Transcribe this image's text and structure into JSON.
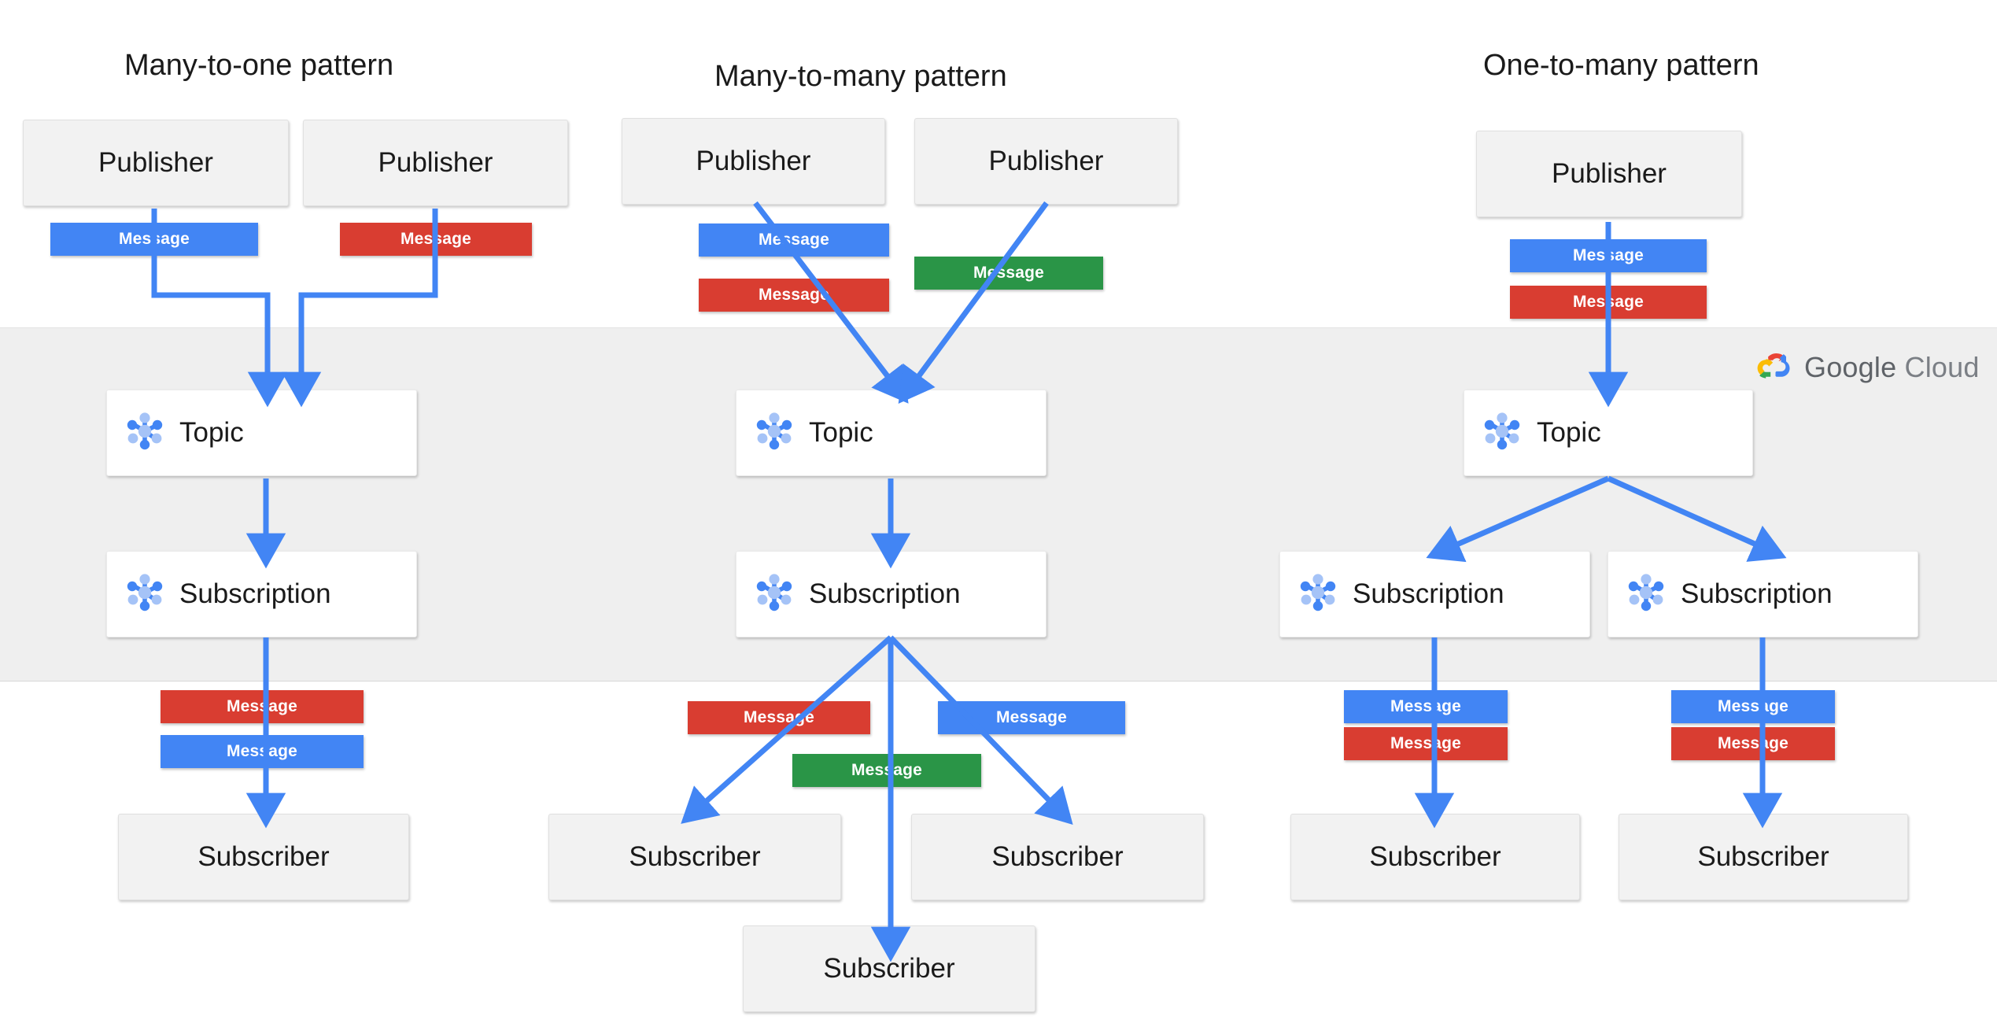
{
  "diagram": {
    "title": "Google Cloud Pub/Sub messaging patterns",
    "brand": {
      "name_first": "Google",
      "name_second": "Cloud",
      "logo_colors": {
        "red": "#EA4335",
        "yellow": "#FBBC05",
        "green": "#34A853",
        "blue": "#4285F4"
      },
      "text_color": "#5F6368"
    },
    "band": {
      "name": "google-cloud-region",
      "background": "#EFEFEF"
    },
    "palette": {
      "message_blue": "#4285F4",
      "message_red": "#D93D31",
      "message_green": "#2A9547",
      "arrow_blue": "#4285F4",
      "endpoint_fill": "#F2F2F2",
      "service_fill": "#FFFFFF",
      "icon_light": "#A5C3F7",
      "icon_dark": "#4285F4"
    },
    "columns": [
      {
        "id": "many-to-one",
        "title": "Many-to-one pattern",
        "publishers": [
          {
            "label": "Publisher"
          },
          {
            "label": "Publisher"
          }
        ],
        "publish_messages": [
          {
            "label": "Message",
            "color": "blue"
          },
          {
            "label": "Message",
            "color": "red"
          }
        ],
        "topics": [
          {
            "label": "Topic"
          }
        ],
        "subscriptions": [
          {
            "label": "Subscription"
          }
        ],
        "deliver_messages": [
          {
            "label": "Message",
            "color": "red"
          },
          {
            "label": "Message",
            "color": "blue"
          }
        ],
        "subscribers": [
          {
            "label": "Subscriber"
          }
        ]
      },
      {
        "id": "many-to-many",
        "title": "Many-to-many  pattern",
        "publishers": [
          {
            "label": "Publisher"
          },
          {
            "label": "Publisher"
          }
        ],
        "publish_messages": [
          {
            "label": "Message",
            "color": "blue"
          },
          {
            "label": "Message",
            "color": "red"
          },
          {
            "label": "Message",
            "color": "green"
          }
        ],
        "topics": [
          {
            "label": "Topic"
          }
        ],
        "subscriptions": [
          {
            "label": "Subscription"
          }
        ],
        "deliver_messages": [
          {
            "label": "Message",
            "color": "red"
          },
          {
            "label": "Message",
            "color": "blue"
          },
          {
            "label": "Message",
            "color": "green"
          }
        ],
        "subscribers": [
          {
            "label": "Subscriber"
          },
          {
            "label": "Subscriber"
          },
          {
            "label": "Subscriber"
          }
        ]
      },
      {
        "id": "one-to-many",
        "title": "One-to-many pattern",
        "publishers": [
          {
            "label": "Publisher"
          }
        ],
        "publish_messages": [
          {
            "label": "Message",
            "color": "blue"
          },
          {
            "label": "Message",
            "color": "red"
          }
        ],
        "topics": [
          {
            "label": "Topic"
          }
        ],
        "subscriptions": [
          {
            "label": "Subscription"
          },
          {
            "label": "Subscription"
          }
        ],
        "deliver_messages": [
          {
            "label": "Message",
            "color": "blue"
          },
          {
            "label": "Message",
            "color": "red"
          },
          {
            "label": "Message",
            "color": "blue"
          },
          {
            "label": "Message",
            "color": "red"
          }
        ],
        "subscribers": [
          {
            "label": "Subscriber"
          },
          {
            "label": "Subscriber"
          }
        ]
      }
    ]
  }
}
